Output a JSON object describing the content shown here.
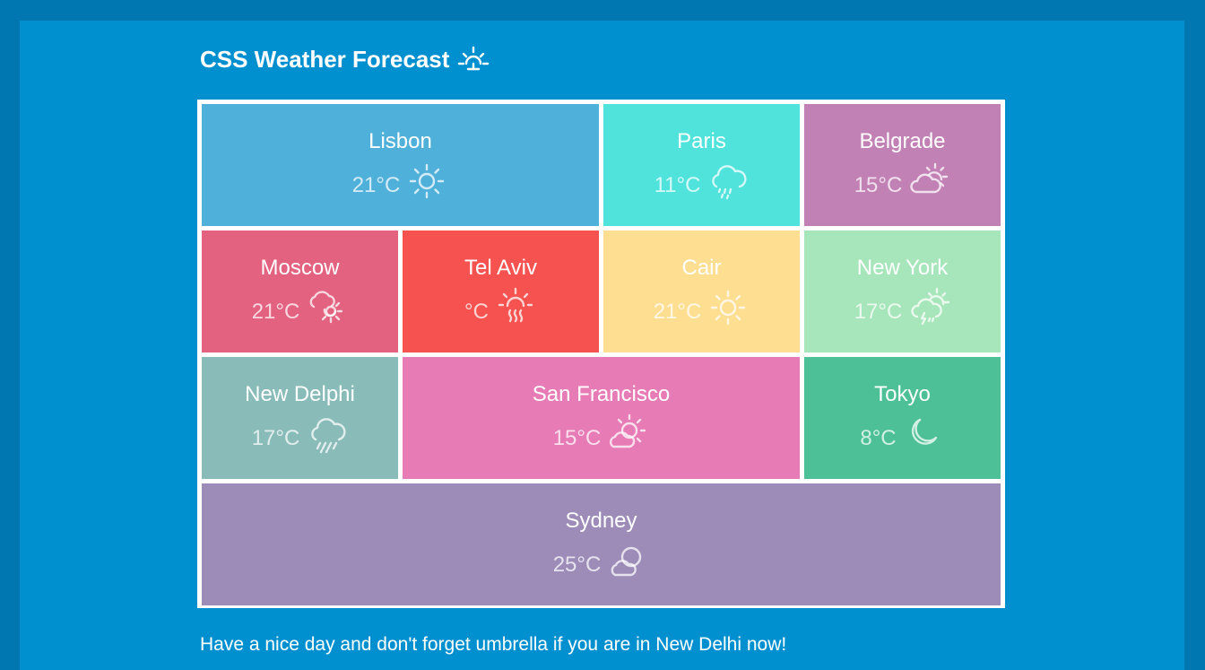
{
  "page": {
    "title": "CSS Weather Forecast",
    "title_icon": "sunrise-icon",
    "footer": "Have a nice day and don't forget umbrella if you are in New Delhi now!"
  },
  "colors": {
    "page_bg": "#0077b0",
    "panel_bg": "#0190cf",
    "grid_border": "#ffffff"
  },
  "cities": [
    {
      "name": "Lisbon",
      "temp": "21°C",
      "icon": "sun-icon",
      "color": "#4fb0da"
    },
    {
      "name": "Paris",
      "temp": "11°C",
      "icon": "cloud-rain-icon",
      "color": "#4fe3dc"
    },
    {
      "name": "Belgrade",
      "temp": "15°C",
      "icon": "cloud-sun-icon",
      "color": "#c181b4"
    },
    {
      "name": "Moscow",
      "temp": "21°C",
      "icon": "cloud-sun-icon",
      "color": "#e26280"
    },
    {
      "name": "Tel Aviv",
      "temp": "°C",
      "icon": "sun-haze-icon",
      "color": "#f6524f"
    },
    {
      "name": "Cair",
      "temp": "21°C",
      "icon": "sun-icon",
      "color": "#fedf92"
    },
    {
      "name": "New York",
      "temp": "17°C",
      "icon": "cloud-sun-lightning-icon",
      "color": "#a7e5bb"
    },
    {
      "name": "New Delphi",
      "temp": "17°C",
      "icon": "cloud-rain-icon",
      "color": "#89bcb9"
    },
    {
      "name": "San Francisco",
      "temp": "15°C",
      "icon": "sun-cloud-icon",
      "color": "#e77bb5"
    },
    {
      "name": "Tokyo",
      "temp": "8°C",
      "icon": "moon-icon",
      "color": "#4dc097"
    },
    {
      "name": "Sydney",
      "temp": "25°C",
      "icon": "sun-cloud-icon",
      "color": "#9d8cb8"
    }
  ]
}
